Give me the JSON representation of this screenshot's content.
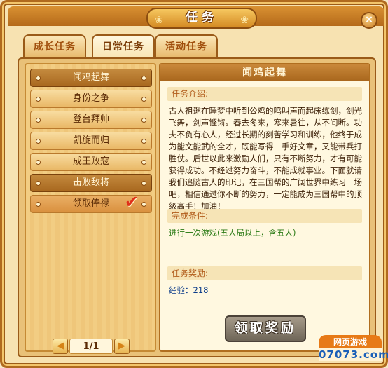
{
  "window": {
    "title": "任务",
    "close_label": "×"
  },
  "tabs": [
    {
      "label": "成长任务",
      "active": false
    },
    {
      "label": "日常任务",
      "active": true
    },
    {
      "label": "活动任务",
      "active": false
    }
  ],
  "quest_list": {
    "items": [
      {
        "label": "闻鸡起舞",
        "state": "selected"
      },
      {
        "label": "身份之争",
        "state": "normal"
      },
      {
        "label": "登台拜帅",
        "state": "normal"
      },
      {
        "label": "凯旋而归",
        "state": "normal"
      },
      {
        "label": "成王败寇",
        "state": "normal"
      },
      {
        "label": "击败敌将",
        "state": "completed"
      },
      {
        "label": "领取俸禄",
        "state": "done",
        "check_icon": "checkmark-icon"
      }
    ],
    "pager": {
      "current": "1/1",
      "prev_icon": "◀",
      "next_icon": "▶"
    }
  },
  "detail": {
    "title": "闻鸡起舞",
    "intro_label": "任务介绍:",
    "intro_text": "古人祖逖在睡梦中听到公鸡的鸣叫声而起床练剑，剑光飞舞，剑声铿锵。春去冬来，寒来暑往，从不间断。功夫不负有心人，经过长期的刻苦学习和训练，他终于成为能文能武的全才，既能写得一手好文章，又能带兵打胜仗。后世以此来激励人们，只有不断努力，才有可能获得成功。不经过努力奋斗，不能成就事业。下面就请我们追随古人的印记，在三国帮的广阔世界中练习一场吧，相信通过你不断的努力，一定能成为三国帮中的顶级高手！加油！",
    "condition_label": "完成条件:",
    "condition_text": "进行一次游戏(五人局以上，含五人)",
    "reward_label": "任务奖励:",
    "reward_text": "经验：218",
    "claim_button_label": "领取奖励"
  },
  "watermark": {
    "top": "网页游戏",
    "bottom": "07073.com"
  },
  "colors": {
    "frame_border": "#b06a1e",
    "selected_item": "#a8681f",
    "condition_text": "#2a7a14",
    "reward_text": "#0d3d8a",
    "check": "#e0301a"
  }
}
